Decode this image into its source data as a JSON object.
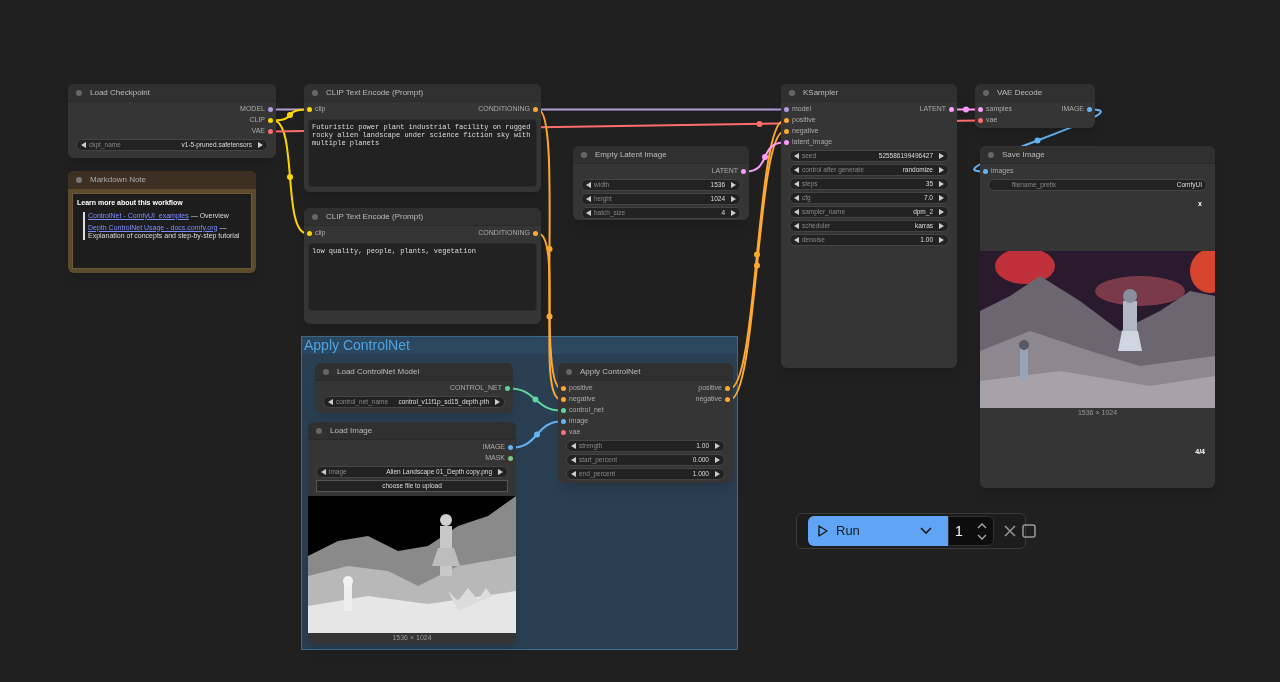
{
  "group": {
    "title": "Apply ControlNet"
  },
  "nodes": [
    {
      "kind": "node",
      "title": "Load Checkpoint",
      "outputs": [
        {
          "name": "MODEL",
          "color": "#b39ddb"
        },
        {
          "name": "CLIP",
          "color": "#ffd500"
        },
        {
          "name": "VAE",
          "color": "#ff6e6e"
        }
      ],
      "widgets": [
        {
          "kind": "combo",
          "label": "ckpt_name",
          "value": "v1-5-pruned.safetensors"
        }
      ]
    },
    {
      "kind": "note",
      "title": "Markdown Note",
      "heading": "Learn more about this workflow",
      "links": [
        {
          "text": "ControlNet - ComfyUI_examples",
          "note": " — Overview"
        },
        {
          "text": "Depth ControlNet Usage - docs.comfy.org",
          "note": " — Explanation of concepts and step-by-step tutorial"
        }
      ]
    },
    {
      "kind": "node",
      "title": "CLIP Text Encode (Prompt)",
      "inputs": [
        {
          "name": "clip",
          "color": "#ffd500"
        }
      ],
      "outputs": [
        {
          "name": "CONDITIONING",
          "color": "#ffa931"
        }
      ],
      "widgets": [
        {
          "kind": "textarea",
          "value": "Futuristic power plant industrial facility on rugged rocky alien landscape under science fiction sky with multiple planets"
        }
      ]
    },
    {
      "kind": "node",
      "title": "CLIP Text Encode (Prompt)",
      "inputs": [
        {
          "name": "clip",
          "color": "#ffd500"
        }
      ],
      "outputs": [
        {
          "name": "CONDITIONING",
          "color": "#ffa931"
        }
      ],
      "widgets": [
        {
          "kind": "textarea",
          "value": "low quality, people, plants, vegetation"
        }
      ]
    },
    {
      "kind": "node",
      "title": "Empty Latent Image",
      "outputs": [
        {
          "name": "LATENT",
          "color": "#ff9cf9"
        }
      ],
      "widgets": [
        {
          "kind": "number",
          "label": "width",
          "value": "1536"
        },
        {
          "kind": "number",
          "label": "height",
          "value": "1024"
        },
        {
          "kind": "number",
          "label": "batch_size",
          "value": "4"
        }
      ]
    },
    {
      "kind": "node",
      "title": "KSampler",
      "inputs": [
        {
          "name": "model",
          "color": "#b39ddb"
        },
        {
          "name": "positive",
          "color": "#ffa931"
        },
        {
          "name": "negative",
          "color": "#ffa931"
        },
        {
          "name": "latent_image",
          "color": "#ff9cf9"
        }
      ],
      "outputs": [
        {
          "name": "LATENT",
          "color": "#ff9cf9"
        }
      ],
      "widgets": [
        {
          "kind": "number",
          "label": "seed",
          "value": "525586199496427"
        },
        {
          "kind": "combo",
          "label": "control after generate",
          "value": "randomize"
        },
        {
          "kind": "number",
          "label": "steps",
          "value": "35"
        },
        {
          "kind": "number",
          "label": "cfg",
          "value": "7.0"
        },
        {
          "kind": "combo",
          "label": "sampler_name",
          "value": "dpm_2"
        },
        {
          "kind": "combo",
          "label": "scheduler",
          "value": "karras"
        },
        {
          "kind": "number",
          "label": "denoise",
          "value": "1.00"
        }
      ]
    },
    {
      "kind": "node",
      "title": "VAE Decode",
      "inputs": [
        {
          "name": "samples",
          "color": "#ff9cf9"
        },
        {
          "name": "vae",
          "color": "#ff6e6e"
        }
      ],
      "outputs": [
        {
          "name": "IMAGE",
          "color": "#64b5f6"
        }
      ]
    },
    {
      "kind": "node",
      "title": "Save Image",
      "inputs": [
        {
          "name": "images",
          "color": "#64b5f6"
        }
      ],
      "widgets": [
        {
          "kind": "text",
          "label": "filename_prefix",
          "value": "ComfyUI"
        }
      ],
      "preview": {
        "close": "x",
        "caption": "1536 × 1024",
        "counter": "4/4"
      }
    },
    {
      "kind": "node",
      "title": "Load ControlNet Model",
      "outputs": [
        {
          "name": "CONTROL_NET",
          "color": "#5fd6a0"
        }
      ],
      "widgets": [
        {
          "kind": "combo",
          "label": "control_net_name",
          "value": "control_v11f1p_sd15_depth.pth"
        }
      ]
    },
    {
      "kind": "node",
      "title": "Load Image",
      "outputs": [
        {
          "name": "IMAGE",
          "color": "#64b5f6"
        },
        {
          "name": "MASK",
          "color": "#81c784"
        }
      ],
      "widgets": [
        {
          "kind": "combo",
          "label": "image",
          "value": "Alien Landscape 01_Depth copy.png"
        },
        {
          "kind": "upload",
          "label": "choose file to upload"
        }
      ],
      "preview": {
        "caption": "1536 × 1024"
      }
    },
    {
      "kind": "node",
      "title": "Apply ControlNet",
      "inputs": [
        {
          "name": "positive",
          "color": "#ffa931"
        },
        {
          "name": "negative",
          "color": "#ffa931"
        },
        {
          "name": "control_net",
          "color": "#5fd6a0"
        },
        {
          "name": "image",
          "color": "#64b5f6"
        },
        {
          "name": "vae",
          "color": "#ff6e6e"
        }
      ],
      "outputs": [
        {
          "name": "positive",
          "color": "#ffa931"
        },
        {
          "name": "negative",
          "color": "#ffa931"
        }
      ],
      "widgets": [
        {
          "kind": "number",
          "label": "strength",
          "value": "1.00"
        },
        {
          "kind": "number",
          "label": "start_percent",
          "value": "0.000"
        },
        {
          "kind": "number",
          "label": "end_percent",
          "value": "1.000"
        }
      ]
    }
  ],
  "toolbar": {
    "run": "Run",
    "count": "1"
  }
}
